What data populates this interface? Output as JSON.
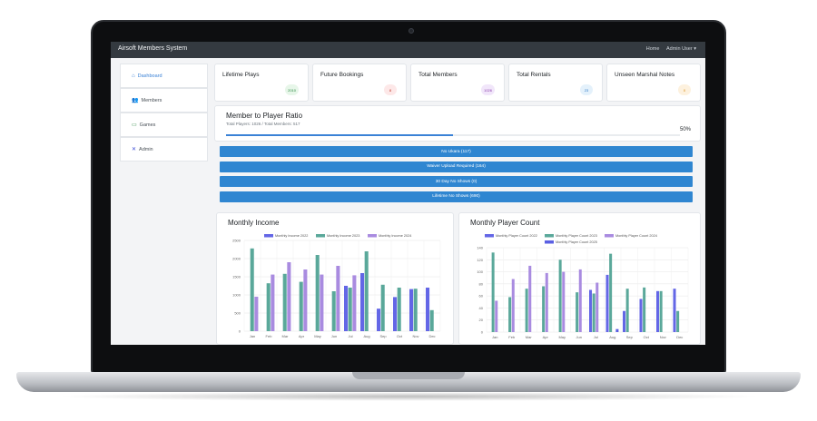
{
  "app": {
    "title": "Airsoft Members System"
  },
  "nav": {
    "home": "Home",
    "user": "Admin User ▾"
  },
  "sidebar": {
    "items": [
      {
        "label": "Dashboard",
        "icon": "home-icon",
        "glyph": "⌂"
      },
      {
        "label": "Members",
        "icon": "members-icon",
        "glyph": "👥"
      },
      {
        "label": "Games",
        "icon": "games-icon",
        "glyph": "▭"
      },
      {
        "label": "Admin",
        "icon": "admin-icon",
        "glyph": "✕"
      }
    ]
  },
  "cards": [
    {
      "title": "Lifetime Plays",
      "value": "2010",
      "bg": "#e7f6e9",
      "fg": "#2e8b45"
    },
    {
      "title": "Future Bookings",
      "value": "8",
      "bg": "#fde8e8",
      "fg": "#c0392b"
    },
    {
      "title": "Total Members",
      "value": "1026",
      "bg": "#f1e6fa",
      "fg": "#8e44ad"
    },
    {
      "title": "Total Rentals",
      "value": "23",
      "bg": "#e4f1fb",
      "fg": "#2d78c6"
    },
    {
      "title": "Unseen Marshal Notes",
      "value": "0",
      "bg": "#fdf1de",
      "fg": "#d68910"
    }
  ],
  "ratio": {
    "title": "Member to Player Ratio",
    "subtitle": "Total Players: 1026 / Total Members: 517",
    "percent_label": "50%",
    "progress": 0.5
  },
  "alerts": [
    {
      "label": "No Ukara (117)"
    },
    {
      "label": "Waiver Upload Required (164)"
    },
    {
      "label": "30 Day No Shows (0)"
    },
    {
      "label": "Lifetime No Shows (690)"
    }
  ],
  "colors": {
    "accent": "#3b82d6",
    "alert": "#2f86d1",
    "s2022": "#6366e6",
    "s2023": "#5aa89a",
    "s2024": "#a98be0",
    "s2025": "#5a5fe3"
  },
  "chart_data": [
    {
      "type": "bar",
      "title": "Monthly Income",
      "categories": [
        "Jan",
        "Feb",
        "Mar",
        "Apr",
        "May",
        "Jun",
        "Jul",
        "Aug",
        "Sep",
        "Oct",
        "Nov",
        "Dec"
      ],
      "ylim": [
        0,
        2500
      ],
      "yticks": [
        "0",
        "500",
        "1000",
        "1500",
        "2000",
        "2500"
      ],
      "series": [
        {
          "name": "Monthly Income 2022",
          "values": [
            null,
            null,
            null,
            null,
            null,
            null,
            1250,
            1600,
            620,
            940,
            1160,
            1200
          ]
        },
        {
          "name": "Monthly Income 2023",
          "values": [
            2280,
            1320,
            1580,
            1360,
            2100,
            1100,
            1200,
            2200,
            1280,
            1200,
            1170,
            580
          ]
        },
        {
          "name": "Monthly Income 2024",
          "values": [
            950,
            1560,
            1900,
            1700,
            1560,
            1800,
            1540,
            null,
            null,
            null,
            null,
            null
          ]
        }
      ]
    },
    {
      "type": "bar",
      "title": "Monthly Player Count",
      "categories": [
        "Jan",
        "Feb",
        "Mar",
        "Apr",
        "May",
        "Jun",
        "Jul",
        "Aug",
        "Sep",
        "Oct",
        "Nov",
        "Dec"
      ],
      "ylim": [
        0,
        140
      ],
      "yticks": [
        "0",
        "20",
        "40",
        "60",
        "80",
        "100",
        "120",
        "140"
      ],
      "series": [
        {
          "name": "Monthly Player Count 2022",
          "values": [
            null,
            null,
            null,
            null,
            null,
            null,
            70,
            95,
            35,
            55,
            68,
            72
          ]
        },
        {
          "name": "Monthly Player Count 2023",
          "values": [
            132,
            58,
            72,
            76,
            120,
            66,
            64,
            130,
            72,
            74,
            68,
            35
          ]
        },
        {
          "name": "Monthly Player Count 2024",
          "values": [
            52,
            88,
            110,
            98,
            100,
            104,
            82,
            null,
            null,
            null,
            null,
            null
          ]
        },
        {
          "name": "Monthly Player Count 2025",
          "values": [
            null,
            null,
            null,
            null,
            null,
            null,
            null,
            5,
            null,
            null,
            null,
            null
          ]
        }
      ]
    }
  ]
}
